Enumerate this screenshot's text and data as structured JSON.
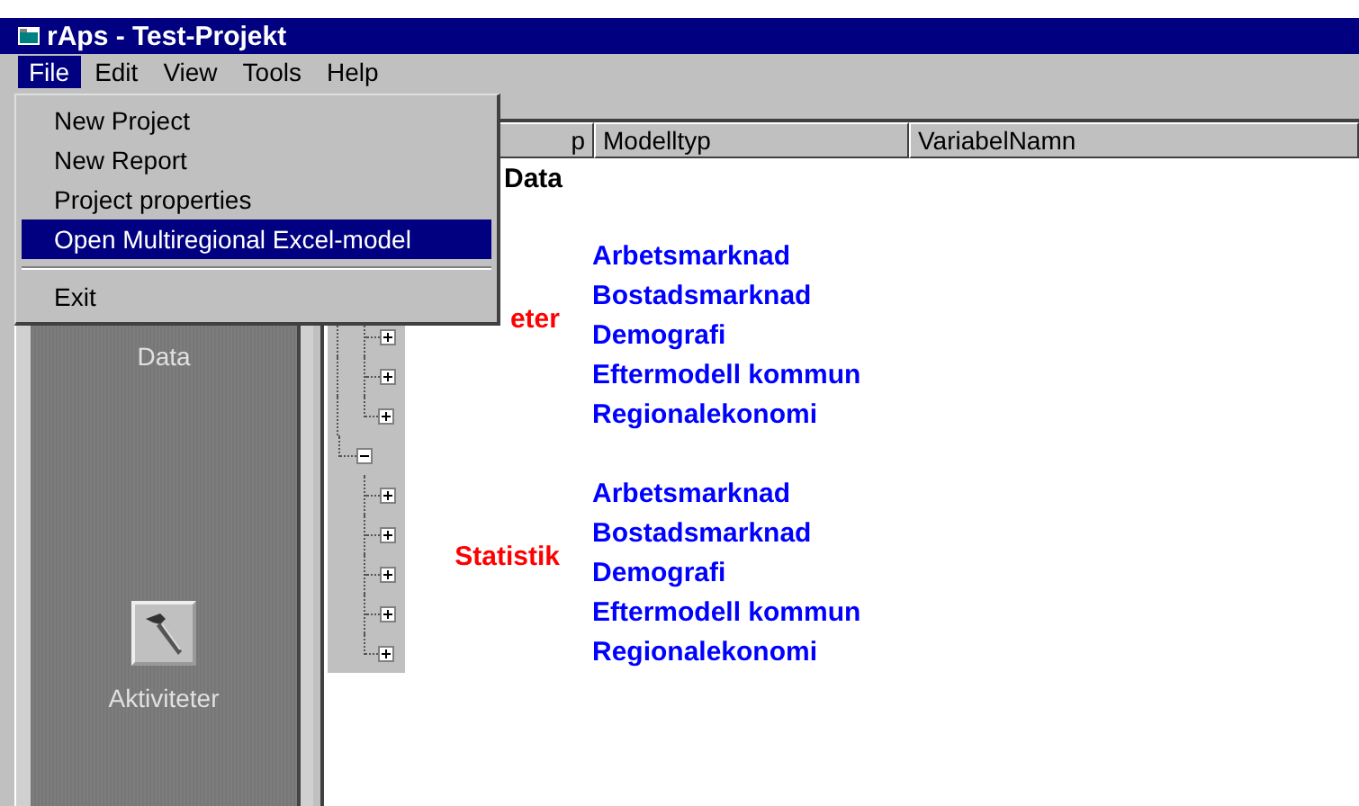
{
  "window": {
    "title": "rAps - Test-Projekt"
  },
  "menu_bar": [
    {
      "label": "File",
      "selected": true
    },
    {
      "label": "Edit",
      "selected": false
    },
    {
      "label": "View",
      "selected": false
    },
    {
      "label": "Tools",
      "selected": false
    },
    {
      "label": "Help",
      "selected": false
    }
  ],
  "file_menu": [
    {
      "kind": "item",
      "label": "New Project",
      "selected": false
    },
    {
      "kind": "item",
      "label": "New Report",
      "selected": false
    },
    {
      "kind": "item",
      "label": "Project properties",
      "selected": false
    },
    {
      "kind": "item",
      "label": "Open Multiregional Excel-model",
      "selected": true
    },
    {
      "kind": "separator"
    },
    {
      "kind": "item",
      "label": "Exit",
      "selected": false
    }
  ],
  "sidebar": [
    {
      "label": "Data",
      "kind": "text"
    },
    {
      "label": "Aktiviteter",
      "kind": "tool"
    }
  ],
  "table": {
    "columns": [
      "p",
      "Modelltyp",
      "VariabelNamn"
    ],
    "tree": {
      "label": "Data",
      "groups": [
        {
          "label": "eter",
          "items": [
            {
              "label": "Arbetsmarknad"
            },
            {
              "label": "Bostadsmarknad"
            },
            {
              "label": "Demografi",
              "expanded": false
            },
            {
              "label": "Eftermodell kommun",
              "expanded": false
            },
            {
              "label": "Regionalekonomi",
              "expanded": false
            }
          ]
        },
        {
          "label": "Statistik",
          "expanded": true,
          "items": [
            {
              "label": "Arbetsmarknad",
              "expanded": false
            },
            {
              "label": "Bostadsmarknad",
              "expanded": false
            },
            {
              "label": "Demografi",
              "expanded": false
            },
            {
              "label": "Eftermodell kommun",
              "expanded": false
            },
            {
              "label": "Regionalekonomi",
              "expanded": false
            }
          ]
        }
      ]
    }
  }
}
